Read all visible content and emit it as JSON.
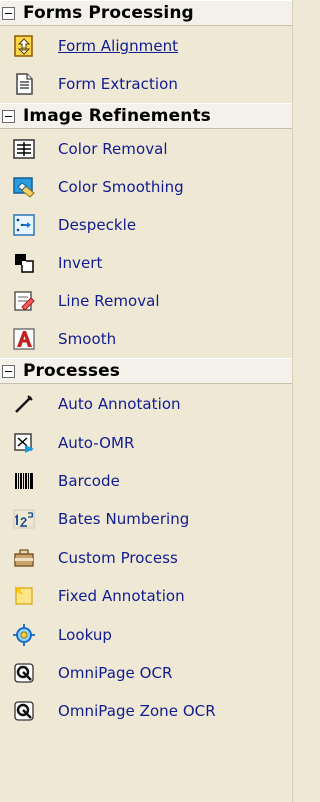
{
  "colors": {
    "panel_bg": "#efe8d4",
    "header_bg": "#f3f1ea",
    "link_text": "#111c8f"
  },
  "sections": [
    {
      "title": "Forms Processing",
      "items": [
        {
          "label": "Form Alignment",
          "icon": "form-alignment-icon"
        },
        {
          "label": "Form Extraction",
          "icon": "form-extraction-icon"
        }
      ]
    },
    {
      "title": "Image Refinements",
      "items": [
        {
          "label": "Color Removal",
          "icon": "color-removal-icon"
        },
        {
          "label": "Color Smoothing",
          "icon": "color-smoothing-icon"
        },
        {
          "label": "Despeckle",
          "icon": "despeckle-icon"
        },
        {
          "label": "Invert",
          "icon": "invert-icon"
        },
        {
          "label": "Line Removal",
          "icon": "line-removal-icon"
        },
        {
          "label": "Smooth",
          "icon": "smooth-icon"
        }
      ]
    },
    {
      "title": "Processes",
      "items": [
        {
          "label": "Auto Annotation",
          "icon": "auto-annotation-icon"
        },
        {
          "label": "Auto-OMR",
          "icon": "auto-omr-icon"
        },
        {
          "label": "Barcode",
          "icon": "barcode-icon"
        },
        {
          "label": "Bates Numbering",
          "icon": "bates-numbering-icon"
        },
        {
          "label": "Custom Process",
          "icon": "custom-process-icon"
        },
        {
          "label": "Fixed Annotation",
          "icon": "fixed-annotation-icon"
        },
        {
          "label": "Lookup",
          "icon": "lookup-icon"
        },
        {
          "label": "OmniPage OCR",
          "icon": "omnipage-ocr-icon"
        },
        {
          "label": "OmniPage Zone OCR",
          "icon": "omnipage-zone-ocr-icon"
        }
      ]
    }
  ]
}
